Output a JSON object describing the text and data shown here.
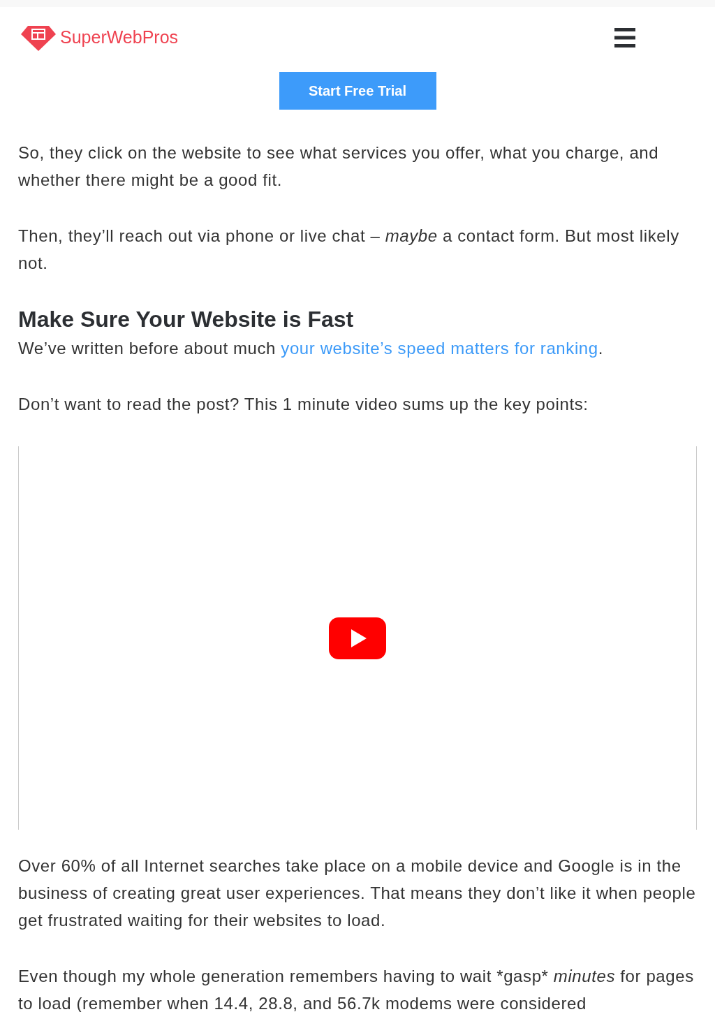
{
  "header": {
    "logo_text": "SuperWebPros",
    "cta": "Start Free Trial"
  },
  "sections": [
    {
      "kind": "paragraph",
      "segments": [
        {
          "kind": "normal",
          "text": "So, they click on the website to see what services you offer, what you charge, and whether there might be a good fit."
        }
      ]
    },
    {
      "kind": "paragraph",
      "segments": [
        {
          "kind": "normal",
          "text": "Then, they’ll reach out via phone or live chat – "
        },
        {
          "kind": "italic",
          "text": "maybe"
        },
        {
          "kind": "normal",
          "text": " a contact form. But most likely not."
        }
      ]
    },
    {
      "kind": "heading",
      "segments": [
        {
          "kind": "normal",
          "text": "Make Sure Your Website is Fast"
        }
      ]
    },
    {
      "kind": "paragraph",
      "segments": [
        {
          "kind": "normal",
          "text": "We’ve written before about much "
        },
        {
          "kind": "link",
          "text": "your website’s speed matters for ranking"
        },
        {
          "kind": "normal",
          "text": "."
        }
      ]
    },
    {
      "kind": "paragraph",
      "segments": [
        {
          "kind": "normal",
          "text": "Don’t want to read the post? This 1 minute video sums up the key points:"
        }
      ]
    },
    {
      "kind": "video"
    },
    {
      "kind": "paragraph",
      "segments": [
        {
          "kind": "normal",
          "text": "Over 60% of all Internet searches take place on a mobile device and Google is in the business of creating great user experiences. That means they don’t like it when people get frustrated waiting for their websites to load."
        }
      ]
    },
    {
      "kind": "paragraph",
      "segments": [
        {
          "kind": "normal",
          "text": "Even though my whole generation remembers having to wait *gasp* "
        },
        {
          "kind": "italic",
          "text": "minutes"
        },
        {
          "kind": "normal",
          "text": " for pages to load (remember when 14.4, 28.8, and 56.7k modems were considered"
        }
      ]
    }
  ]
}
